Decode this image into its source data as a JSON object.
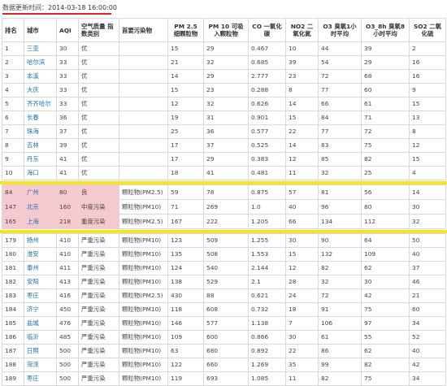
{
  "header": {
    "update_label": "数据更新时间：",
    "update_time": "2014-03-18 16:00:00"
  },
  "table": {
    "columns": [
      "排名",
      "城市",
      "AQI",
      "空气质量 指数类别",
      "首要污染物",
      "PM 2.5 细颗粒物",
      "PM 10 可吸入颗粒物",
      "CO 一氧化碳",
      "NO2 二氧化氮",
      "O3 臭氧1小时平均",
      "O3_8h 臭氧8小时平均",
      "SO2 二氧化硫"
    ],
    "top_rows": [
      [
        "1",
        "三亚",
        "30",
        "优",
        "",
        "15",
        "29",
        "0.467",
        "10",
        "44",
        "39",
        "2"
      ],
      [
        "2",
        "哈尔滨",
        "33",
        "优",
        "",
        "21",
        "32",
        "0.685",
        "39",
        "54",
        "29",
        "16"
      ],
      [
        "3",
        "本溪",
        "33",
        "优",
        "",
        "14",
        "29",
        "2.777",
        "23",
        "72",
        "68",
        "16"
      ],
      [
        "4",
        "大庆",
        "33",
        "优",
        "",
        "15",
        "23",
        "0.288",
        "8",
        "77",
        "60",
        "9"
      ],
      [
        "5",
        "齐齐哈尔",
        "33",
        "优",
        "",
        "12",
        "32",
        "0.626",
        "14",
        "66",
        "61",
        "15"
      ],
      [
        "6",
        "长春",
        "36",
        "优",
        "",
        "19",
        "31",
        "0.901",
        "15",
        "84",
        "71",
        "13"
      ],
      [
        "7",
        "珠海",
        "37",
        "优",
        "",
        "25",
        "36",
        "0.577",
        "22",
        "77",
        "72",
        "8"
      ],
      [
        "8",
        "吉林",
        "39",
        "优",
        "",
        "17",
        "37",
        "0.525",
        "14",
        "83",
        "75",
        "12"
      ],
      [
        "9",
        "丹东",
        "41",
        "优",
        "",
        "17",
        "29",
        "0.383",
        "12",
        "85",
        "82",
        "15"
      ],
      [
        "10",
        "海口",
        "41",
        "优",
        "",
        "18",
        "41",
        "0.481",
        "11",
        "32",
        "25",
        "4"
      ]
    ],
    "highlight_rows": [
      [
        "84",
        "广州",
        "80",
        "良",
        "颗粒物(PM2.5)",
        "59",
        "78",
        "0.875",
        "57",
        "81",
        "56",
        "14"
      ],
      [
        "147",
        "北京",
        "160",
        "中度污染",
        "颗粒物(PM10)",
        "71",
        "269",
        "1.0",
        "40",
        "96",
        "80",
        "30"
      ],
      [
        "165",
        "上海",
        "218",
        "重度污染",
        "颗粒物(PM2.5)",
        "167",
        "222",
        "1.205",
        "66",
        "134",
        "112",
        "32"
      ]
    ],
    "bottom_rows": [
      [
        "179",
        "扬州",
        "410",
        "严重污染",
        "颗粒物(PM10)",
        "123",
        "509",
        "1.255",
        "30",
        "90",
        "64",
        "50"
      ],
      [
        "180",
        "淮安",
        "410",
        "严重污染",
        "颗粒物(PM10)",
        "135",
        "508",
        "1.553",
        "15",
        "132",
        "109",
        "40"
      ],
      [
        "181",
        "泰州",
        "411",
        "严重污染",
        "颗粒物(PM10)",
        "124",
        "540",
        "2.144",
        "12",
        "82",
        "62",
        "37"
      ],
      [
        "182",
        "安阳",
        "413",
        "严重污染",
        "颗粒物(PM10)",
        "138",
        "529",
        "2.1",
        "28",
        "32",
        "30",
        "46"
      ],
      [
        "183",
        "枣庄",
        "416",
        "严重污染",
        "颗粒物(PM2.5)",
        "430",
        "88",
        "0.621",
        "24",
        "72",
        "42",
        "21"
      ],
      [
        "184",
        "济宁",
        "450",
        "严重污染",
        "颗粒物(PM10)",
        "118",
        "608",
        "0.732",
        "18",
        "91",
        "75",
        "60"
      ],
      [
        "185",
        "盐城",
        "476",
        "严重污染",
        "颗粒物(PM10)",
        "146",
        "577",
        "1.138",
        "7",
        "106",
        "97",
        "34"
      ],
      [
        "186",
        "临沂",
        "485",
        "严重污染",
        "颗粒物(PM10)",
        "109",
        "600",
        "0.866",
        "30",
        "61",
        "55",
        "52"
      ],
      [
        "187",
        "日照",
        "500",
        "严重污染",
        "颗粒物(PM10)",
        "63",
        "680",
        "0.892",
        "22",
        "86",
        "62",
        "40"
      ],
      [
        "188",
        "菏泽",
        "500",
        "严重污染",
        "颗粒物(PM10)",
        "122",
        "660",
        "1.269",
        "35",
        "99",
        "82",
        "42"
      ],
      [
        "189",
        "枣庄",
        "500",
        "严重污染",
        "颗粒物(PM10)",
        "119",
        "693",
        "1.085",
        "11",
        "82",
        "75",
        "34"
      ]
    ]
  },
  "colors": {
    "highlight_band": "#f7e51a",
    "highlight_cells": "#f7c9cf",
    "city_link": "#1b6fb3",
    "underline": "#d8262f"
  }
}
